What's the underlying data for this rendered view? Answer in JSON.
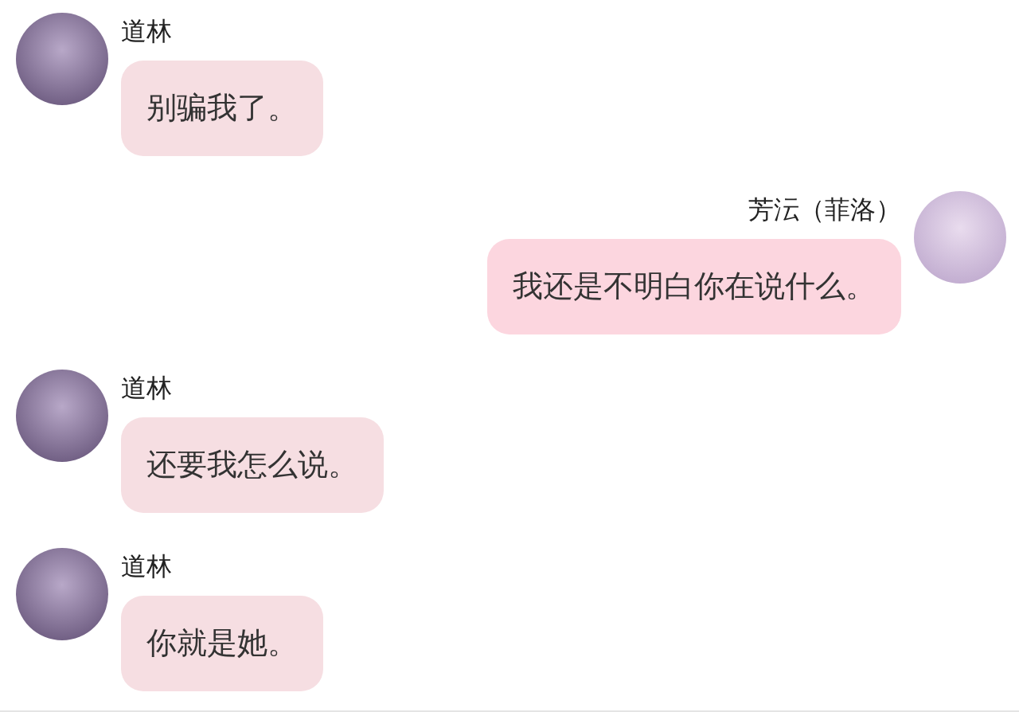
{
  "messages": [
    {
      "kind": "received",
      "name": "道林",
      "text": "别骗我了。"
    },
    {
      "kind": "sent",
      "name": "芳沄（菲洛）",
      "text": "我还是不明白你在说什么。"
    },
    {
      "kind": "received",
      "name": "道林",
      "text": "还要我怎么说。"
    },
    {
      "kind": "received",
      "name": "道林",
      "text": "你就是她。"
    }
  ]
}
